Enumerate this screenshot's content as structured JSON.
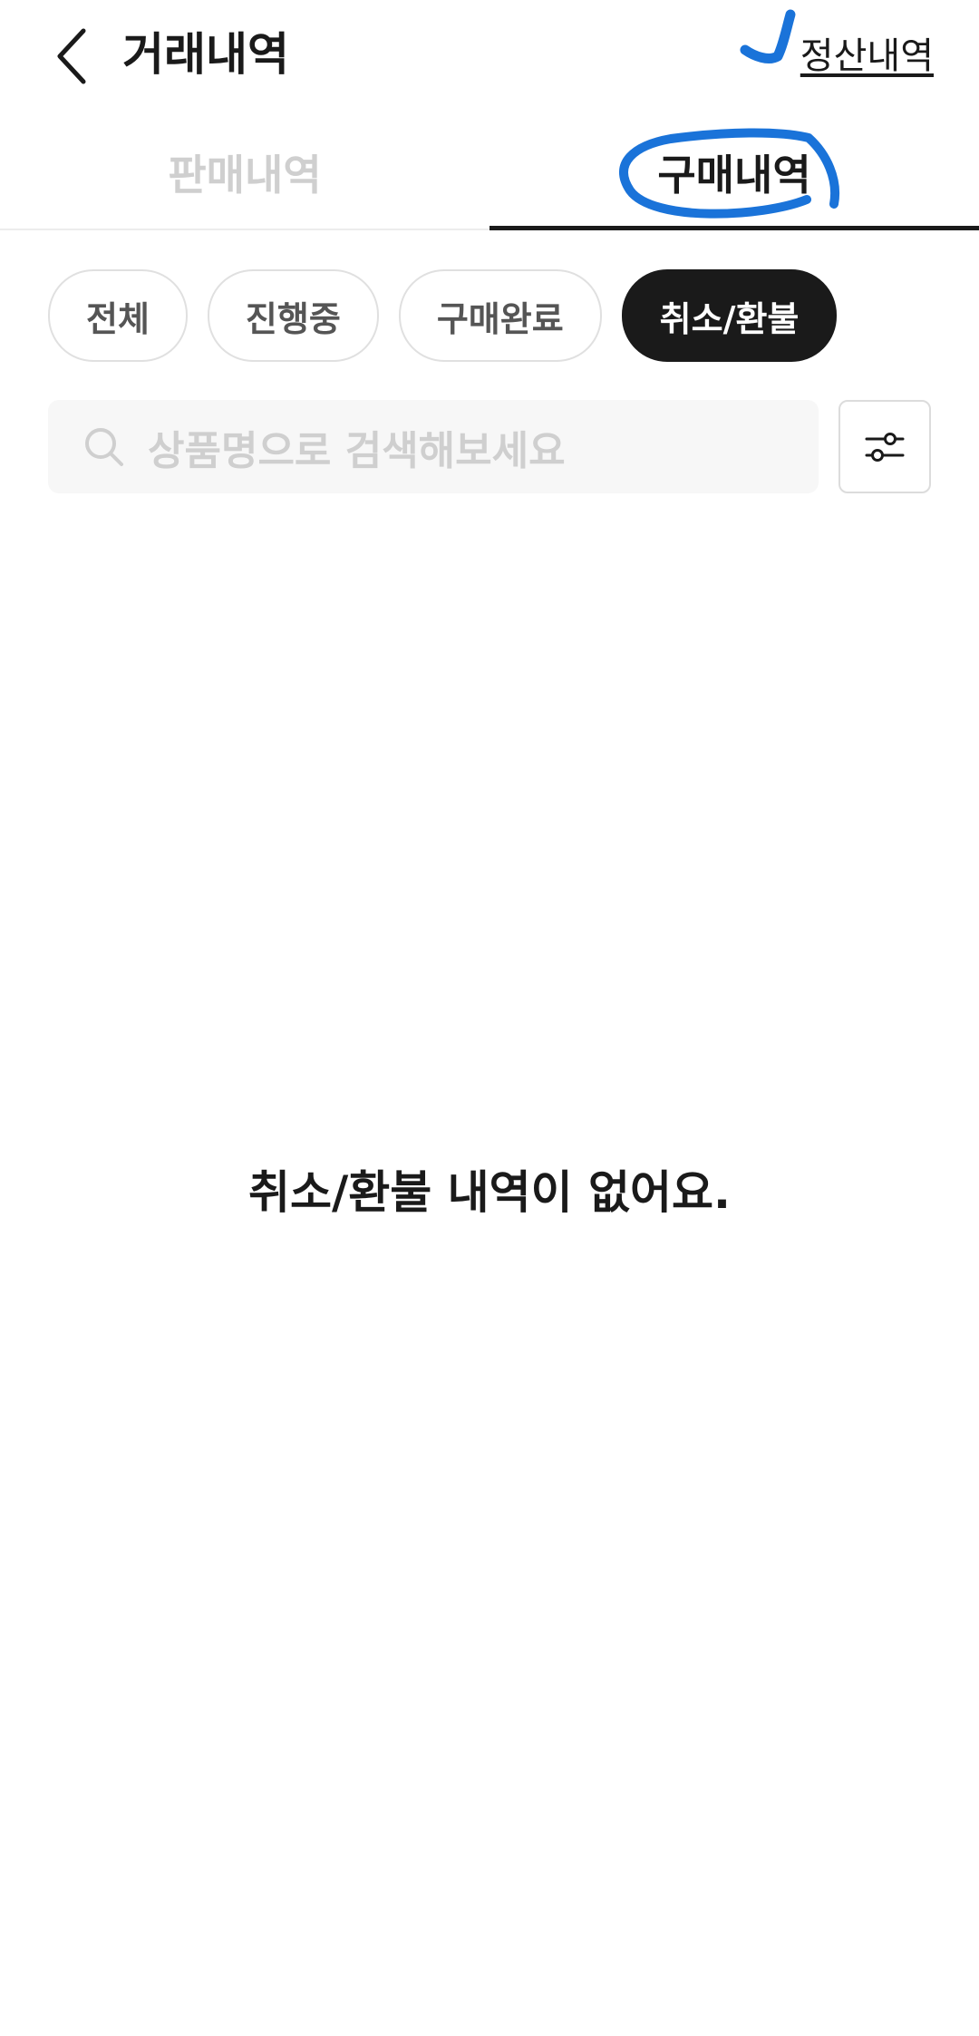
{
  "header": {
    "title": "거래내역",
    "settlement_link": "정산내역",
    "back_icon": "chevron-left-icon"
  },
  "tabs": [
    {
      "label": "판매내역",
      "active": false
    },
    {
      "label": "구매내역",
      "active": true
    }
  ],
  "filters": {
    "chips": [
      {
        "label": "전체",
        "selected": false
      },
      {
        "label": "진행중",
        "selected": false
      },
      {
        "label": "구매완료",
        "selected": false
      },
      {
        "label": "취소/환불",
        "selected": true
      }
    ]
  },
  "search": {
    "placeholder": "상품명으로 검색해보세요",
    "icon": "search-icon",
    "filter_icon": "sliders-icon"
  },
  "empty_state": {
    "message": "취소/환불 내역이 없어요."
  },
  "colors": {
    "text": "#1a1a1a",
    "inactive_text": "#cfcfcf",
    "chip_border": "#e0e0e0",
    "search_bg": "#f7f7f7",
    "annotation": "#1a73d9"
  }
}
